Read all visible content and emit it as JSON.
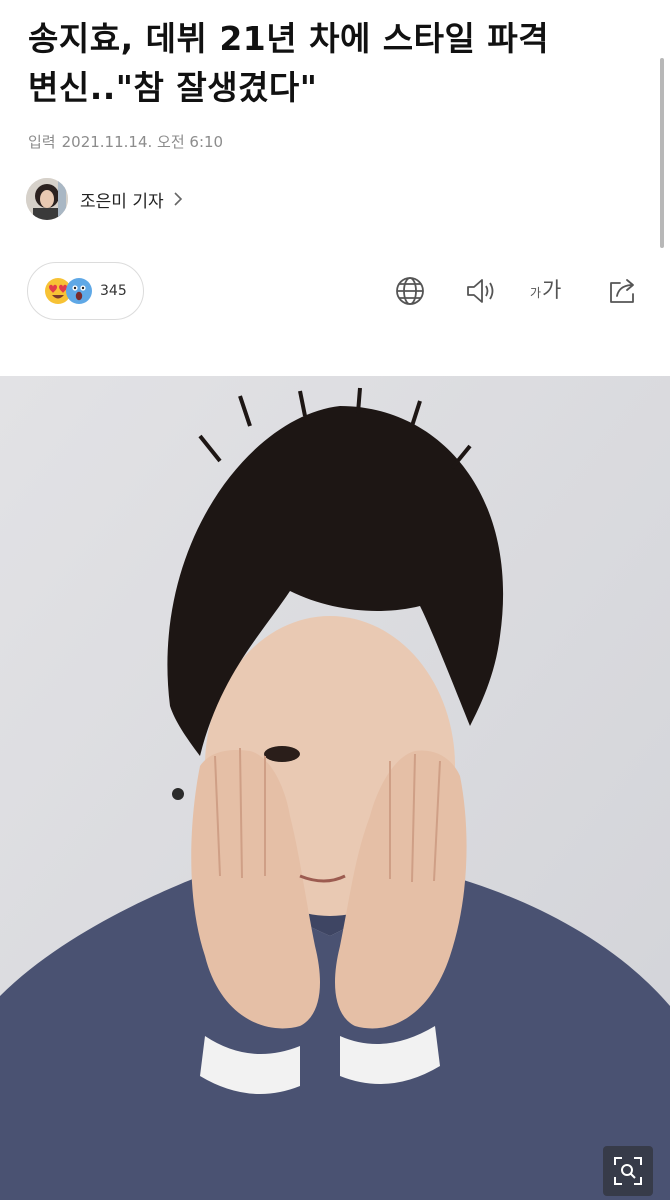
{
  "article": {
    "headline_line1": "송지효, 데뷔 21년 차에 스타일 파격",
    "headline_line2": "변신..\"참 잘생겼다\"",
    "published_label": "입력",
    "published_datetime": "2021.11.14. 오전 6:10",
    "reporter_name": "조은미 기자"
  },
  "reactions": {
    "count": "345",
    "emojis": [
      "heart-eyes-emoji",
      "screaming-emoji"
    ]
  },
  "toolbar": {
    "icons": [
      "globe-icon",
      "speaker-icon",
      "font-size-icon",
      "share-icon"
    ],
    "font_small": "가",
    "font_large": "가"
  },
  "photo": {
    "description_icon": "photo-zoom-icon"
  },
  "colors": {
    "text": "#111111",
    "meta": "#8c8c8c",
    "pill_border": "#dcdcdc",
    "icon": "#555555",
    "photo_bg": "#dcdcdf",
    "sweater": "#4a5272"
  }
}
